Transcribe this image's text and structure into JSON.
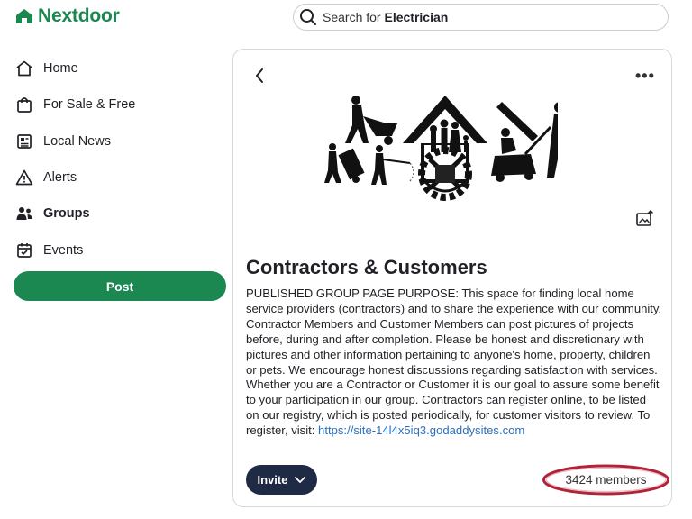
{
  "app": {
    "logo_text": "Nextdoor",
    "brand_color": "#1b8751",
    "logo_icon": "house-icon"
  },
  "search": {
    "prefix": "Search for",
    "term": "Electrician",
    "icon": "search-icon"
  },
  "nav": {
    "items": [
      {
        "label": "Home",
        "icon": "home-icon",
        "active": false
      },
      {
        "label": "For Sale & Free",
        "icon": "shopping-bag-icon",
        "active": false
      },
      {
        "label": "Local News",
        "icon": "newspaper-icon",
        "active": false
      },
      {
        "label": "Alerts",
        "icon": "alert-triangle-icon",
        "active": false
      },
      {
        "label": "Groups",
        "icon": "people-icon",
        "active": true
      },
      {
        "label": "Events",
        "icon": "calendar-icon",
        "active": false
      }
    ],
    "post_label": "Post"
  },
  "group": {
    "title": "Contractors & Customers",
    "description": "PUBLISHED GROUP PAGE PURPOSE: This space for finding local home service providers (contractors) and to share the experience with our community. Contractor Members and Customer Members can post pictures of projects before, during and after completion. Please be honest and discretionary with pictures and other information pertaining to anyone's home, property, children or pets. We encourage honest discussions regarding satisfaction with services. Whether you are a Contractor or Customer it is our goal to assure some benefit to your participation in our group. Contractors can register online, to be listed on our registry, which is posted periodically, for customer visitors to review. To register, visit:",
    "link": "https://site-14l4x5iq3.godaddysites.com",
    "invite_label": "Invite",
    "members_label": "3424 members",
    "highlight_color": "#b0243a",
    "invite_color": "#1f2a44",
    "link_color": "#2b6fc0"
  }
}
